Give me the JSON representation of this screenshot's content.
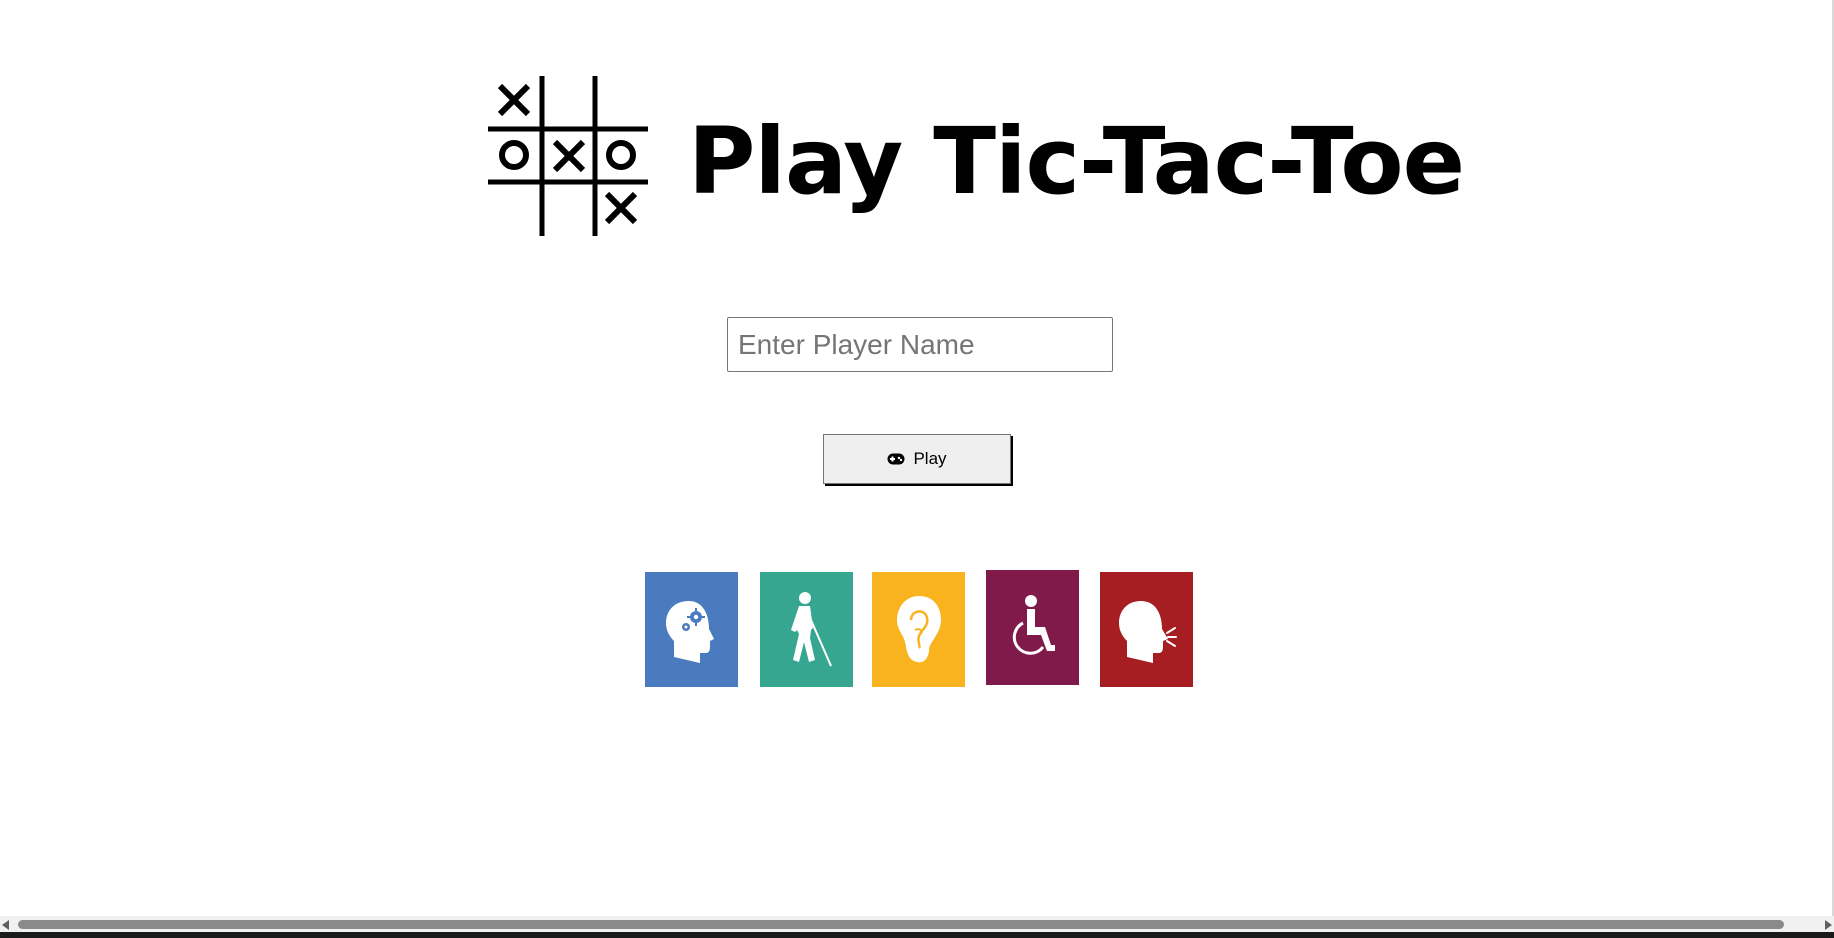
{
  "header": {
    "logo_icon": "tic-tac-toe-board-icon",
    "title": "Play Tic-Tac-Toe"
  },
  "form": {
    "name_placeholder": "Enter Player Name",
    "name_value": "",
    "play_label": "Play",
    "play_icon": "gamepad-icon"
  },
  "accessibility_tiles": [
    {
      "icon": "cognitive-disability-icon",
      "color": "#4a7bbf"
    },
    {
      "icon": "visual-impairment-icon",
      "color": "#36a690"
    },
    {
      "icon": "hearing-impairment-icon",
      "color": "#f8b31e"
    },
    {
      "icon": "wheelchair-icon",
      "color": "#7f1a4a"
    },
    {
      "icon": "speech-impairment-icon",
      "color": "#a61e22"
    }
  ]
}
